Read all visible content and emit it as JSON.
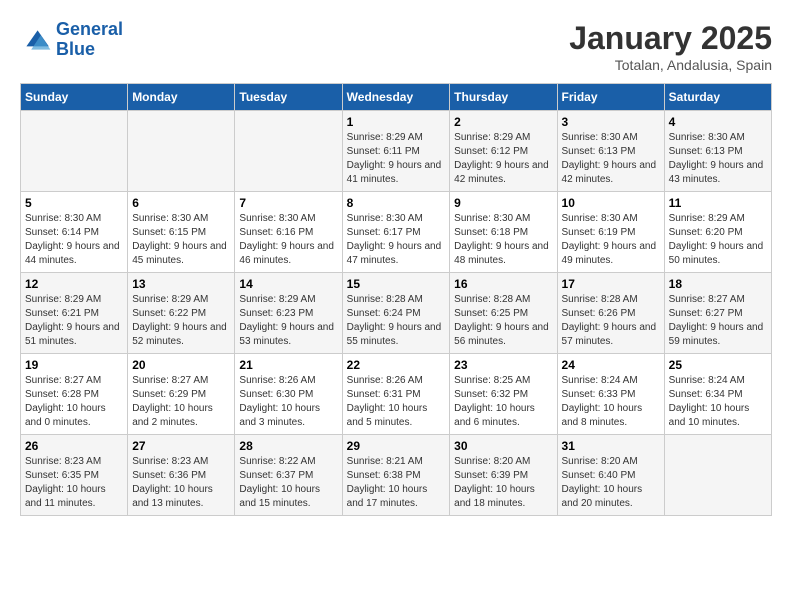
{
  "logo": {
    "line1": "General",
    "line2": "Blue"
  },
  "header": {
    "title": "January 2025",
    "subtitle": "Totalan, Andalusia, Spain"
  },
  "days_of_week": [
    "Sunday",
    "Monday",
    "Tuesday",
    "Wednesday",
    "Thursday",
    "Friday",
    "Saturday"
  ],
  "weeks": [
    [
      {
        "day": "",
        "info": ""
      },
      {
        "day": "",
        "info": ""
      },
      {
        "day": "",
        "info": ""
      },
      {
        "day": "1",
        "info": "Sunrise: 8:29 AM\nSunset: 6:11 PM\nDaylight: 9 hours and 41 minutes."
      },
      {
        "day": "2",
        "info": "Sunrise: 8:29 AM\nSunset: 6:12 PM\nDaylight: 9 hours and 42 minutes."
      },
      {
        "day": "3",
        "info": "Sunrise: 8:30 AM\nSunset: 6:13 PM\nDaylight: 9 hours and 42 minutes."
      },
      {
        "day": "4",
        "info": "Sunrise: 8:30 AM\nSunset: 6:13 PM\nDaylight: 9 hours and 43 minutes."
      }
    ],
    [
      {
        "day": "5",
        "info": "Sunrise: 8:30 AM\nSunset: 6:14 PM\nDaylight: 9 hours and 44 minutes."
      },
      {
        "day": "6",
        "info": "Sunrise: 8:30 AM\nSunset: 6:15 PM\nDaylight: 9 hours and 45 minutes."
      },
      {
        "day": "7",
        "info": "Sunrise: 8:30 AM\nSunset: 6:16 PM\nDaylight: 9 hours and 46 minutes."
      },
      {
        "day": "8",
        "info": "Sunrise: 8:30 AM\nSunset: 6:17 PM\nDaylight: 9 hours and 47 minutes."
      },
      {
        "day": "9",
        "info": "Sunrise: 8:30 AM\nSunset: 6:18 PM\nDaylight: 9 hours and 48 minutes."
      },
      {
        "day": "10",
        "info": "Sunrise: 8:30 AM\nSunset: 6:19 PM\nDaylight: 9 hours and 49 minutes."
      },
      {
        "day": "11",
        "info": "Sunrise: 8:29 AM\nSunset: 6:20 PM\nDaylight: 9 hours and 50 minutes."
      }
    ],
    [
      {
        "day": "12",
        "info": "Sunrise: 8:29 AM\nSunset: 6:21 PM\nDaylight: 9 hours and 51 minutes."
      },
      {
        "day": "13",
        "info": "Sunrise: 8:29 AM\nSunset: 6:22 PM\nDaylight: 9 hours and 52 minutes."
      },
      {
        "day": "14",
        "info": "Sunrise: 8:29 AM\nSunset: 6:23 PM\nDaylight: 9 hours and 53 minutes."
      },
      {
        "day": "15",
        "info": "Sunrise: 8:28 AM\nSunset: 6:24 PM\nDaylight: 9 hours and 55 minutes."
      },
      {
        "day": "16",
        "info": "Sunrise: 8:28 AM\nSunset: 6:25 PM\nDaylight: 9 hours and 56 minutes."
      },
      {
        "day": "17",
        "info": "Sunrise: 8:28 AM\nSunset: 6:26 PM\nDaylight: 9 hours and 57 minutes."
      },
      {
        "day": "18",
        "info": "Sunrise: 8:27 AM\nSunset: 6:27 PM\nDaylight: 9 hours and 59 minutes."
      }
    ],
    [
      {
        "day": "19",
        "info": "Sunrise: 8:27 AM\nSunset: 6:28 PM\nDaylight: 10 hours and 0 minutes."
      },
      {
        "day": "20",
        "info": "Sunrise: 8:27 AM\nSunset: 6:29 PM\nDaylight: 10 hours and 2 minutes."
      },
      {
        "day": "21",
        "info": "Sunrise: 8:26 AM\nSunset: 6:30 PM\nDaylight: 10 hours and 3 minutes."
      },
      {
        "day": "22",
        "info": "Sunrise: 8:26 AM\nSunset: 6:31 PM\nDaylight: 10 hours and 5 minutes."
      },
      {
        "day": "23",
        "info": "Sunrise: 8:25 AM\nSunset: 6:32 PM\nDaylight: 10 hours and 6 minutes."
      },
      {
        "day": "24",
        "info": "Sunrise: 8:24 AM\nSunset: 6:33 PM\nDaylight: 10 hours and 8 minutes."
      },
      {
        "day": "25",
        "info": "Sunrise: 8:24 AM\nSunset: 6:34 PM\nDaylight: 10 hours and 10 minutes."
      }
    ],
    [
      {
        "day": "26",
        "info": "Sunrise: 8:23 AM\nSunset: 6:35 PM\nDaylight: 10 hours and 11 minutes."
      },
      {
        "day": "27",
        "info": "Sunrise: 8:23 AM\nSunset: 6:36 PM\nDaylight: 10 hours and 13 minutes."
      },
      {
        "day": "28",
        "info": "Sunrise: 8:22 AM\nSunset: 6:37 PM\nDaylight: 10 hours and 15 minutes."
      },
      {
        "day": "29",
        "info": "Sunrise: 8:21 AM\nSunset: 6:38 PM\nDaylight: 10 hours and 17 minutes."
      },
      {
        "day": "30",
        "info": "Sunrise: 8:20 AM\nSunset: 6:39 PM\nDaylight: 10 hours and 18 minutes."
      },
      {
        "day": "31",
        "info": "Sunrise: 8:20 AM\nSunset: 6:40 PM\nDaylight: 10 hours and 20 minutes."
      },
      {
        "day": "",
        "info": ""
      }
    ]
  ]
}
